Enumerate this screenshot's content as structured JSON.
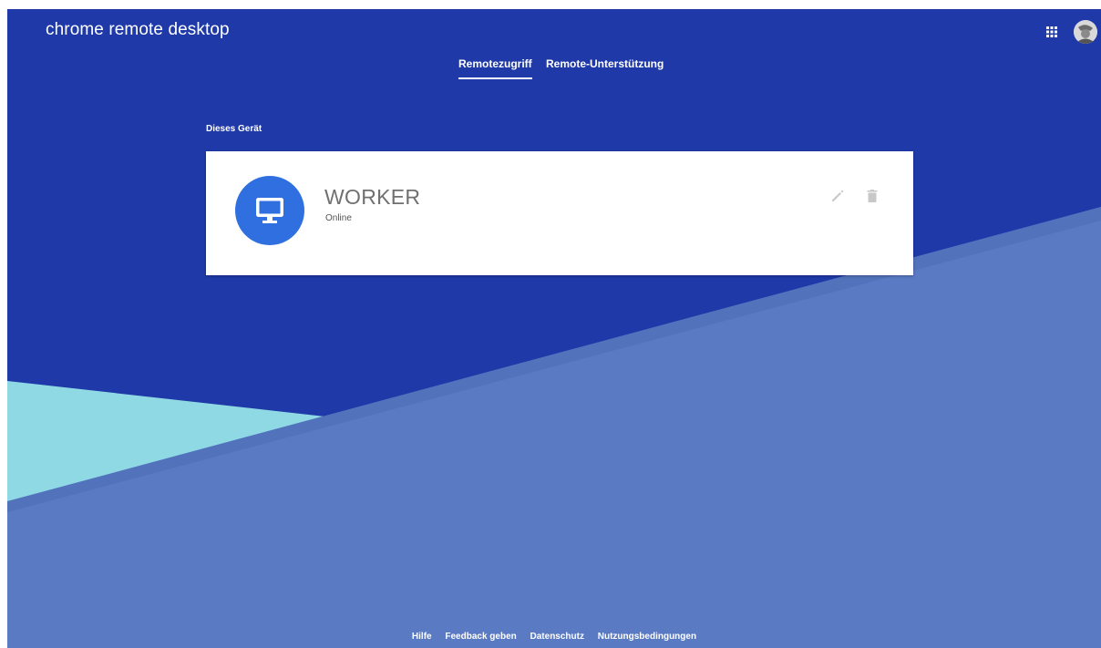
{
  "header": {
    "brand": "chrome remote desktop",
    "apps_icon": "apps-grid-icon",
    "avatar_icon": "account-avatar-icon"
  },
  "tabs": [
    {
      "label": "Remotezugriff",
      "active": true
    },
    {
      "label": "Remote-Unterstützung",
      "active": false
    }
  ],
  "section": {
    "title": "Dieses Gerät"
  },
  "device": {
    "name": "WORKER",
    "status": "Online",
    "icon": "computer-monitor-icon",
    "edit_icon": "pencil-icon",
    "delete_icon": "trash-icon"
  },
  "footer": {
    "links": [
      "Hilfe",
      "Feedback geben",
      "Datenschutz",
      "Nutzungsbedingungen"
    ]
  },
  "colors": {
    "primary_blue": "#1f3aa8",
    "lower_blue": "#5a7ac4",
    "teal": "#8fd9e4",
    "icon_blue": "#2f6fe0"
  }
}
